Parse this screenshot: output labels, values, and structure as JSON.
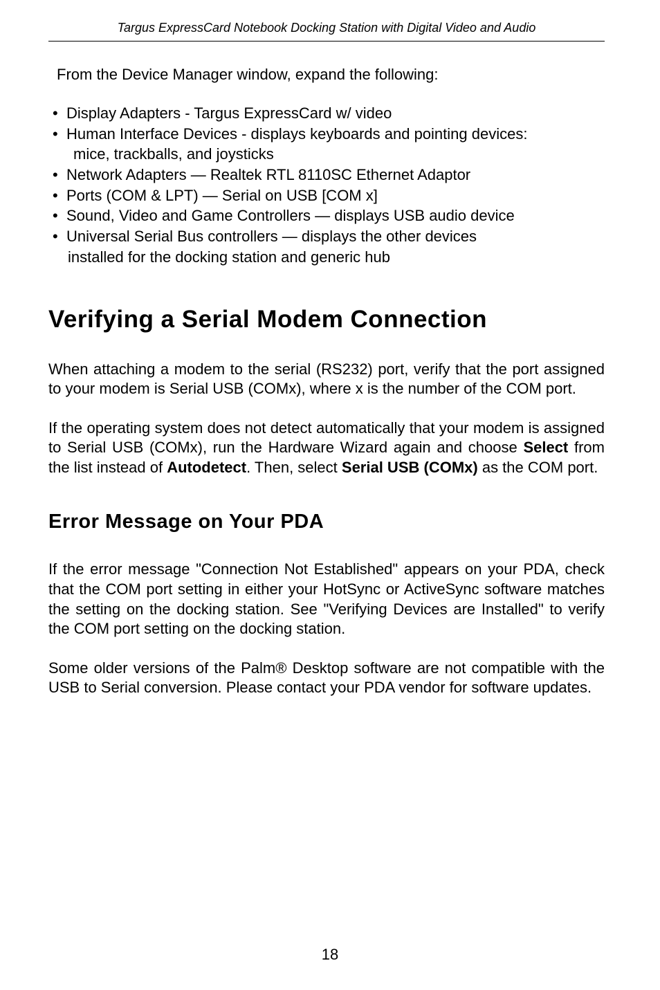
{
  "header": "Targus ExpressCard Notebook Docking Station with Digital Video and Audio",
  "intro": "From the Device Manager window, expand the following:",
  "bullets": {
    "b1": "Display Adapters - Targus ExpressCard w/ video",
    "b2a": "Human Interface Devices - displays keyboards and pointing devices:",
    "b2b": "mice, trackballs, and joysticks",
    "b3": "Network Adapters — Realtek RTL 8110SC Ethernet Adaptor",
    "b4": "Ports (COM & LPT) — Serial on USB [COM x]",
    "b5": "Sound, Video and Game Controllers — displays USB audio device",
    "b6a": "Universal Serial Bus controllers — displays the other devices",
    "b6b": "installed for the docking station and generic hub"
  },
  "h1": "Verifying a Serial Modem Connection",
  "p1": "When attaching a modem to the serial (RS232) port, verify that the port assigned to your modem is Serial USB (COMx), where x is the number of the COM port.",
  "p2a": "If the operating system does not detect automatically that your modem is assigned to Serial USB (COMx), run the Hardware Wizard again and choose ",
  "p2b": "Select",
  "p2c": " from the list instead of ",
  "p2d": "Autodetect",
  "p2e": ". Then, select ",
  "p2f": "Serial USB (COMx)",
  "p2g": " as the COM port.",
  "h2": "Error Message on Your PDA",
  "p3": "If the error message \"Connection Not Established\" appears on your PDA, check that the COM port setting in either your HotSync or ActiveSync software matches the setting on the docking station. See \"Verifying Devices are Installed\" to verify the COM port setting on the docking station.",
  "p4": "Some older versions of the Palm® Desktop software are not compatible with the USB to Serial conversion. Please contact your PDA vendor for software updates.",
  "pagenum": "18"
}
